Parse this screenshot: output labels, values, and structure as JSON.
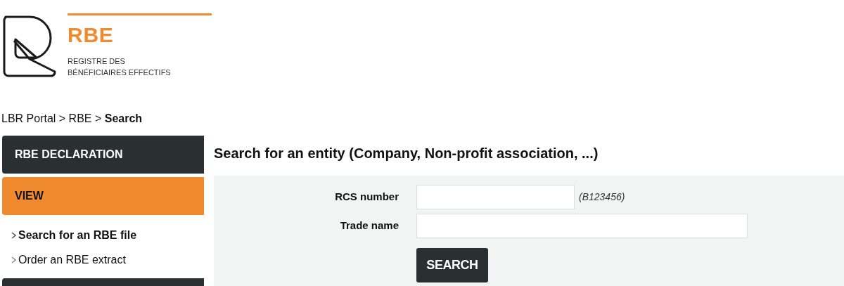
{
  "logo": {
    "name": "RBE",
    "subtitle_lines": [
      "REGISTRE DES",
      "BÉNÉFICIAIRES EFFECTIFS"
    ]
  },
  "breadcrumb": "LBR Portal > RBE > **Search**",
  "sidebar": {
    "sections": [
      {
        "label": "RBE DECLARATION",
        "selected": false
      },
      {
        "label": "VIEW",
        "selected": true,
        "items": [
          {
            "label": "Search for an RBE file",
            "selected": true
          },
          {
            "label": "Order an RBE extract",
            "selected": false
          }
        ]
      },
      {
        "selected": false
      }
    ]
  },
  "title": "Search for an entity (Company, Non-profit association, ...)",
  "form": {
    "fields": [
      {
        "label": "RCS number",
        "kind": "short",
        "hint": "(B123456)"
      },
      {
        "label": "Trade name",
        "kind": "long"
      }
    ],
    "button": "SEARCH"
  }
}
